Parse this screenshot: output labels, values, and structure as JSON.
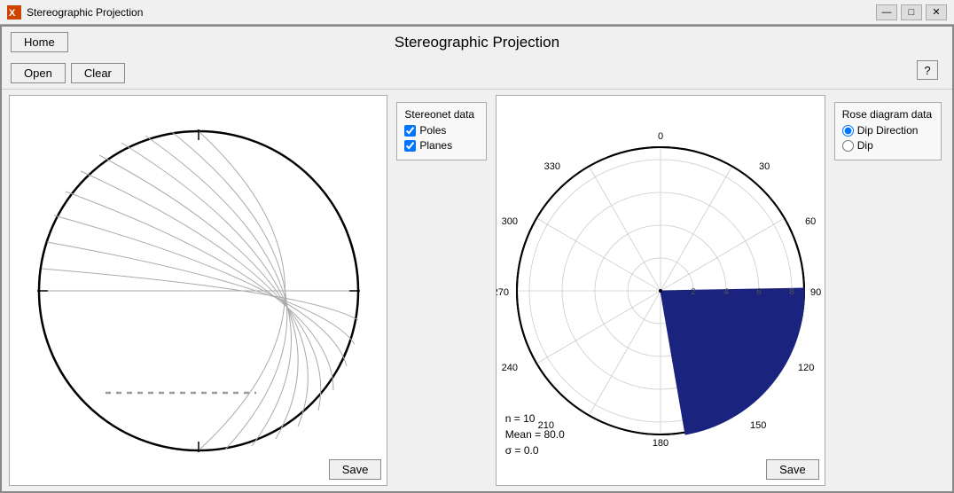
{
  "titlebar": {
    "icon": "X",
    "title": "Stereographic Projection",
    "minimize": "—",
    "maximize": "□",
    "close": "✕"
  },
  "header": {
    "title": "Stereographic Projection",
    "help_label": "?"
  },
  "toolbar": {
    "home_label": "Home",
    "open_label": "Open",
    "clear_label": "Clear"
  },
  "stereonet_data": {
    "title": "Stereonet data",
    "poles_label": "Poles",
    "planes_label": "Planes",
    "poles_checked": true,
    "planes_checked": true
  },
  "rose_diagram_data": {
    "title": "Rose diagram data",
    "dip_direction_label": "Dip Direction",
    "dip_label": "Dip",
    "selected": "dip_direction"
  },
  "stereonet": {
    "save_label": "Save"
  },
  "rose": {
    "save_label": "Save",
    "stats": {
      "n": "n = 10",
      "mean": "Mean = 80.0",
      "sigma": "σ = 0.0"
    }
  },
  "compass_labels": {
    "top": "0",
    "top_right_1": "30",
    "right_top": "60",
    "right": "90",
    "right_bottom": "120",
    "bottom_right": "150",
    "bottom": "180",
    "bottom_left": "210",
    "left_bottom": "240",
    "left": "270",
    "left_top": "300",
    "top_left": "330"
  },
  "radial_labels": {
    "r2": "2",
    "r4": "4",
    "r6": "6",
    "r8": "8"
  },
  "colors": {
    "accent": "#1a237e",
    "border": "#888888",
    "circle_stroke": "#000000",
    "grid_stroke": "#cccccc",
    "dot_fill": "#999999",
    "plane_stroke": "#aaaaaa"
  }
}
